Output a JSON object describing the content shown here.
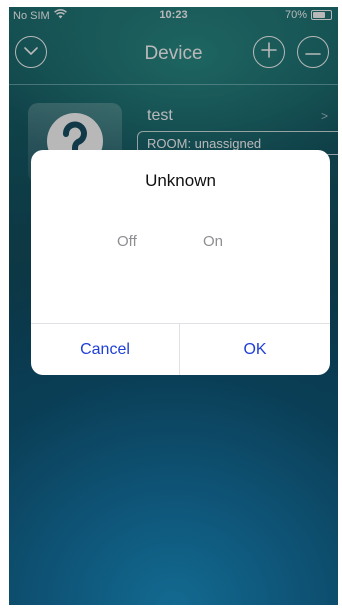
{
  "status_bar": {
    "carrier": "No SIM",
    "time": "10:23",
    "battery": "70%",
    "battery_level": 0.7
  },
  "header": {
    "title": "Device",
    "icons": [
      "chevron-down-icon",
      "plus-icon",
      "minus-icon"
    ]
  },
  "device": {
    "name": "test",
    "room": "ROOM: unassigned",
    "thumb_icon": "question-mark-icon"
  },
  "dialog": {
    "title": "Unknown",
    "options": [
      "Off",
      "On"
    ],
    "cancel_label": "Cancel",
    "ok_label": "OK"
  },
  "colors": {
    "accent": "#1f3fd6",
    "background_top": "#1e6f72",
    "background_bottom": "#1676a8"
  }
}
